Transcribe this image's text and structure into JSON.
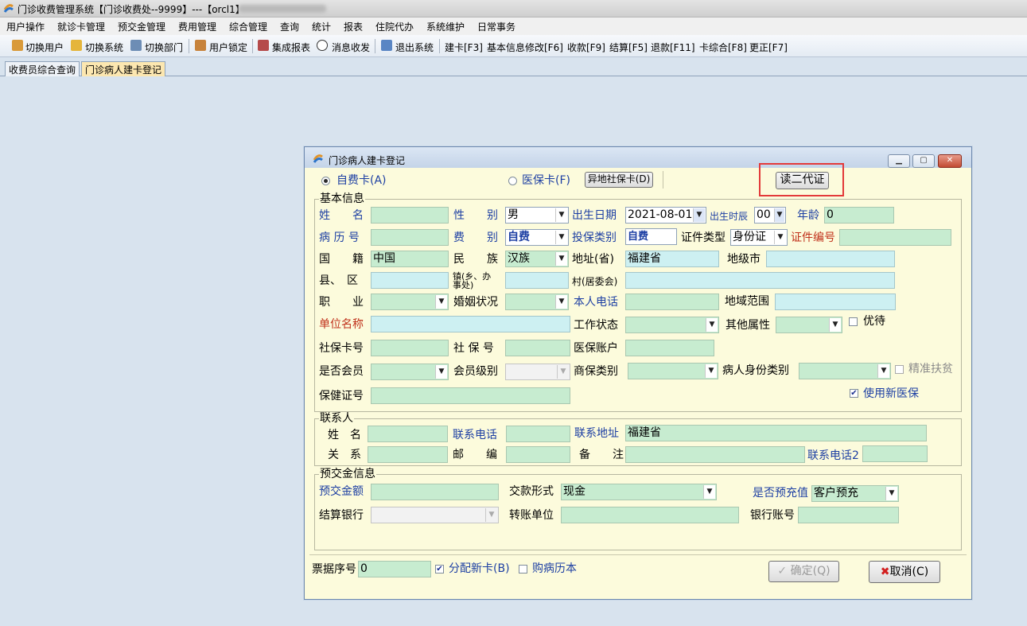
{
  "window": {
    "title": "门诊收费管理系统【门诊收费处--9999】---【orcl1】"
  },
  "menu": [
    "用户操作",
    "就诊卡管理",
    "预交金管理",
    "费用管理",
    "综合管理",
    "查询",
    "统计",
    "报表",
    "住院代办",
    "系统维护",
    "日常事务"
  ],
  "toolbar": {
    "switch_user": "切换用户",
    "switch_system": "切换系统",
    "switch_dept": "切换部门",
    "lock_user": "用户锁定",
    "integrated_report": "集成报表",
    "messages": "消息收发",
    "exit_system": "退出系统",
    "build_card": "建卡[F3]",
    "modify_info": "基本信息修改[F6]",
    "collect": "收款[F9]",
    "settle": "结算[F5]",
    "refund": "退款[F11]",
    "card_general": "卡综合[F8]",
    "correct": "更正[F7]"
  },
  "tabs": [
    "收费员综合查询",
    "门诊病人建卡登记"
  ],
  "dialog": {
    "title": "门诊病人建卡登记",
    "self_pay_card": "自费卡(A)",
    "insurance_card": "医保卡(F)",
    "remote_card_btn": "异地社保卡(D)",
    "read_id_btn": "读二代证",
    "basic": {
      "group": "基本信息",
      "name_label": "姓　　名",
      "name": "",
      "gender_label": "性　　别",
      "gender": "男",
      "birth_label": "出生日期",
      "birth": "2021-08-01",
      "birth_hour_label": "出生时辰",
      "birth_hour": "00",
      "age_label": "年龄",
      "age": "0",
      "record_no_label": "病 历 号",
      "record_no": "",
      "fee_type_label": "费　　别",
      "fee_type": "自费",
      "ins_type_label": "投保类别",
      "ins_type": "自费",
      "id_type_label": "证件类型",
      "id_type": "身份证",
      "id_no_label": "证件编号",
      "id_no": "",
      "native_label": "国　　籍",
      "native": "中国",
      "ethnic_label": "民　　族",
      "ethnic": "汉族",
      "province_label": "地址(省)",
      "province": "福建省",
      "city_label": "地级市",
      "city": "",
      "county_label": "县、　区",
      "county": "",
      "town_label": "镇(乡、办事处)",
      "town": "",
      "village_label": "村(居委会)",
      "village": "",
      "job_label": "职　　业",
      "job": "",
      "marital_label": "婚姻状况",
      "marital": "",
      "phone_label": "本人电话",
      "phone": "",
      "region_label": "地域范围",
      "region": "",
      "unit_label": "单位名称",
      "unit": "",
      "work_status_label": "工作状态",
      "work_status": "",
      "other_attr_label": "其他属性",
      "other_attr": "",
      "vip_label": "优待",
      "social_card_label": "社保卡号",
      "social_card": "",
      "social_no_label": "社 保 号",
      "social_no": "",
      "med_account_label": "医保账户",
      "med_account": "",
      "member_label": "是否会员",
      "member": "",
      "member_level_label": "会员级别",
      "member_level": "",
      "commercial_label": "商保类别",
      "commercial": "",
      "patient_id_type_label": "病人身份类别",
      "patient_id_type": "",
      "poverty_label": "精准扶贫",
      "health_cert_label": "保健证号",
      "health_cert": "",
      "new_insurance_label": "使用新医保"
    },
    "contact": {
      "group": "联系人",
      "name_label": "姓　名",
      "name": "",
      "phone_label": "联系电话",
      "phone": "",
      "address_label": "联系地址",
      "address": "福建省",
      "relation_label": "关　系",
      "relation": "",
      "zip_label": "邮　　编",
      "zip": "",
      "note_label": "备　　注",
      "note": "",
      "phone2_label": "联系电话2",
      "phone2": ""
    },
    "prepay": {
      "group": "预交金信息",
      "amount_label": "预交金额",
      "amount": "",
      "pay_form_label": "交款形式",
      "pay_form": "现金",
      "prepaid_label": "是否预充值",
      "prepaid": "客户预充",
      "bank_label": "结算银行",
      "bank": "",
      "transfer_unit_label": "转账单位",
      "transfer_unit": "",
      "bank_account_label": "银行账号",
      "bank_account": ""
    },
    "footer": {
      "ticket_no_label": "票据序号",
      "ticket_no": "0",
      "assign_card_label": "分配新卡(B)",
      "buy_record_label": "购病历本",
      "ok_label": "确定(Q)",
      "cancel_label": "取消(C)"
    }
  }
}
